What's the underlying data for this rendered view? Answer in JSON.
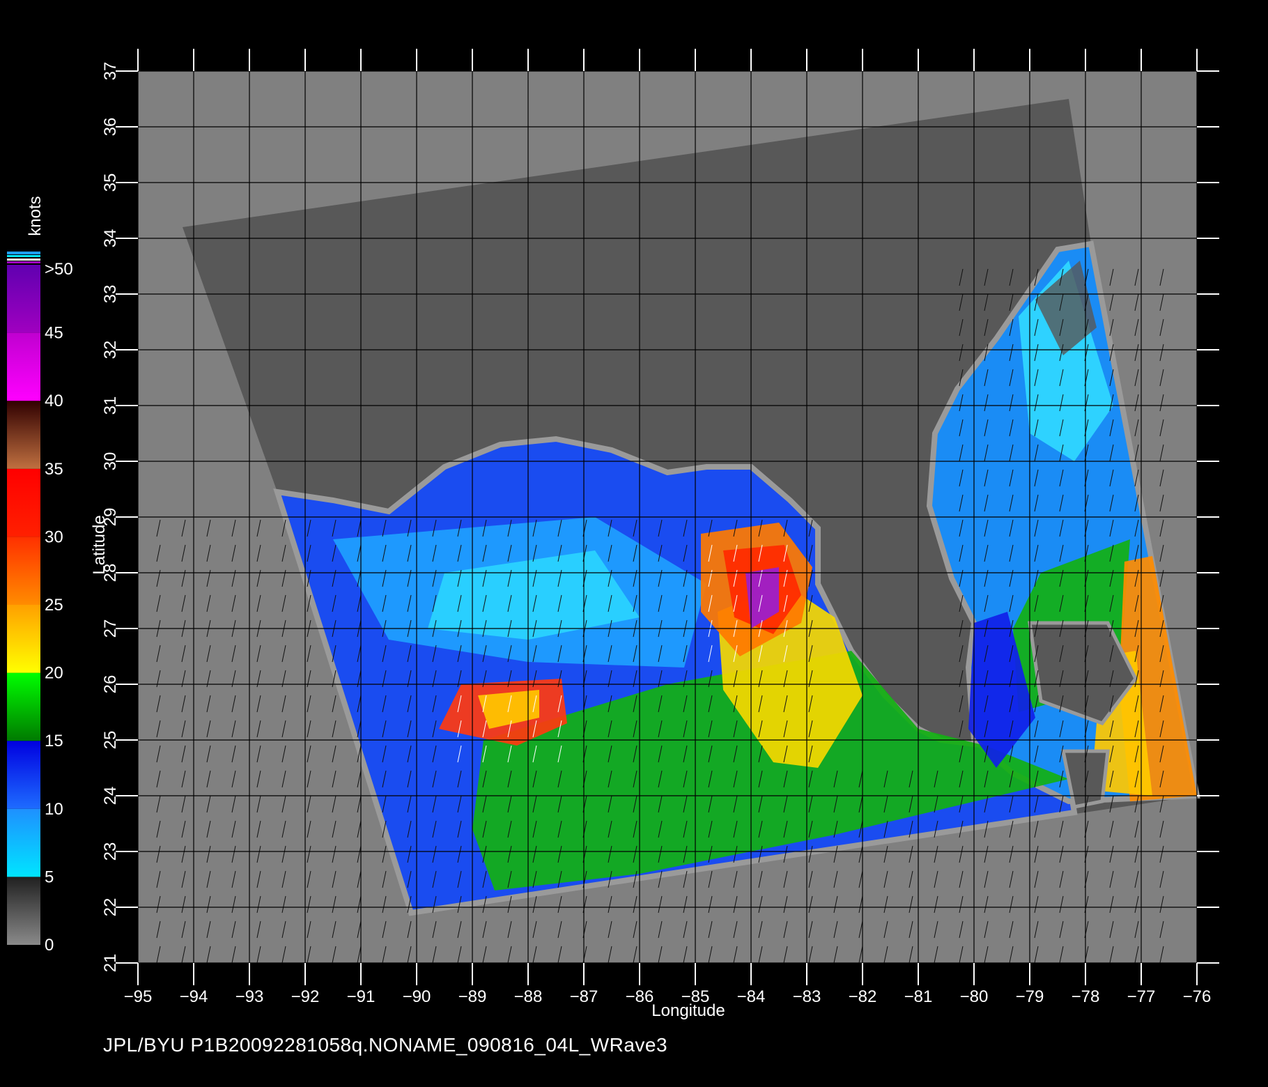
{
  "chart_data": {
    "type": "heatmap",
    "xlabel": "Longitude",
    "ylabel": "Latitude",
    "xlim": [
      -95,
      -76
    ],
    "ylim": [
      21,
      37
    ],
    "x_ticks": [
      "−95",
      "−94",
      "−93",
      "−92",
      "−91",
      "−90",
      "−89",
      "−88",
      "−87",
      "−86",
      "−85",
      "−84",
      "−83",
      "−82",
      "−81",
      "−80",
      "−79",
      "−78",
      "−77",
      "−76"
    ],
    "y_ticks": [
      "21",
      "22",
      "23",
      "24",
      "25",
      "26",
      "27",
      "28",
      "29",
      "30",
      "31",
      "32",
      "33",
      "34",
      "35",
      "36",
      "37"
    ],
    "grid": true,
    "colorbar": {
      "title": "knots",
      "labels": [
        "0",
        "5",
        "10",
        "15",
        "20",
        "25",
        "30",
        "35",
        "40",
        "45",
        ">50"
      ],
      "bands": [
        {
          "from": 0,
          "to": 5,
          "colors": [
            "#8a8a8a",
            "#202020"
          ]
        },
        {
          "from": 5,
          "to": 10,
          "colors": [
            "#00e5ff",
            "#1e90ff"
          ]
        },
        {
          "from": 10,
          "to": 15,
          "colors": [
            "#1e6cff",
            "#0000e0"
          ]
        },
        {
          "from": 15,
          "to": 20,
          "colors": [
            "#007a00",
            "#00ff00"
          ]
        },
        {
          "from": 20,
          "to": 25,
          "colors": [
            "#ffff00",
            "#ffa000"
          ]
        },
        {
          "from": 25,
          "to": 30,
          "colors": [
            "#ff8c00",
            "#ff3000"
          ]
        },
        {
          "from": 30,
          "to": 35,
          "colors": [
            "#ff2000",
            "#ff0000"
          ]
        },
        {
          "from": 35,
          "to": 40,
          "colors": [
            "#c07040",
            "#300000"
          ]
        },
        {
          "from": 40,
          "to": 45,
          "colors": [
            "#ff00ff",
            "#c000d0"
          ]
        },
        {
          "from": 45,
          "to": 50,
          "colors": [
            "#a000c0",
            "#6000b0"
          ]
        }
      ]
    },
    "colors": {
      "background": "#808080",
      "swath_land": "#585858",
      "land_outline": "#9a9a9a",
      "grid": "#000000",
      "frame": "#ffffff"
    }
  },
  "footer_text": "JPL/BYU  P1B20092281058q.NONAME_090816_04L_WRave3"
}
